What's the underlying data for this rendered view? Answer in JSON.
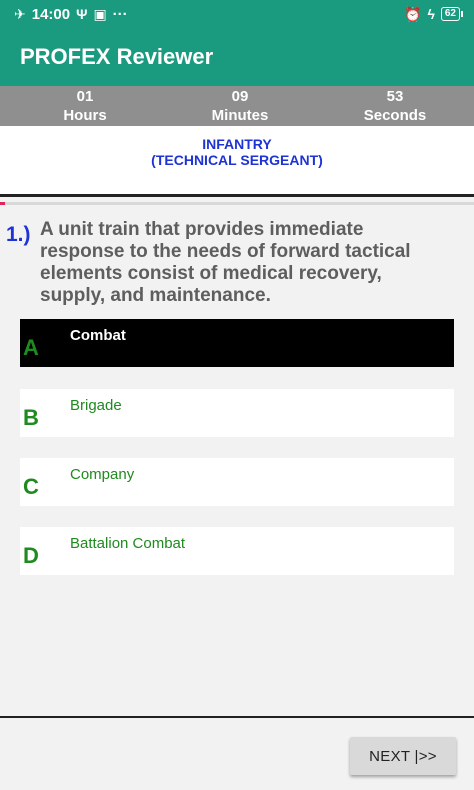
{
  "status_bar": {
    "time": "14:00",
    "dots": "···",
    "battery": "62",
    "icons": [
      "airplane-icon",
      "usb-icon",
      "hotspot-icon",
      "alarm-icon",
      "charging-icon",
      "battery-icon"
    ]
  },
  "app_bar": {
    "title": "PROFEX Reviewer"
  },
  "timer": {
    "hours_value": "01",
    "hours_label": "Hours",
    "minutes_value": "09",
    "minutes_label": "Minutes",
    "seconds_value": "53",
    "seconds_label": "Seconds"
  },
  "category": {
    "line1": "INFANTRY",
    "line2": "(TECHNICAL SERGEANT)"
  },
  "progress": {
    "fraction": 0.01,
    "color": "#e0245e"
  },
  "question": {
    "number": "1.)",
    "text": "A unit train that provides immediate response to the needs of forward tactical elements consist of medical recovery, supply, and maintenance."
  },
  "options": [
    {
      "letter": "A",
      "text": "Combat",
      "selected": true
    },
    {
      "letter": "B",
      "text": "Brigade",
      "selected": false
    },
    {
      "letter": "C",
      "text": "Company",
      "selected": false
    },
    {
      "letter": "D",
      "text": "Battalion Combat",
      "selected": false
    }
  ],
  "next_button": {
    "label": "NEXT |>>"
  },
  "colors": {
    "app_bar": "#1a9a7e",
    "timer_bar": "#8f8f8f",
    "category_text": "#1e33d6",
    "question_number": "#1e33d6",
    "question_text": "#5e5e5e",
    "option_text": "#1f8a1f",
    "selected_option_bg": "#000000"
  }
}
